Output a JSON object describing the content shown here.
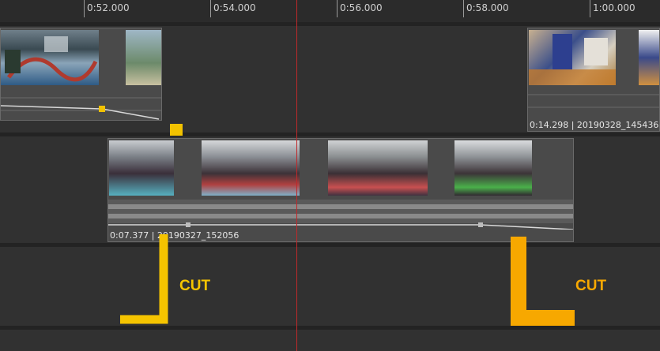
{
  "ruler": {
    "labels": [
      "0:52.000",
      "0:54.000",
      "0:56.000",
      "0:58.000",
      "1:00.000"
    ]
  },
  "clips": {
    "top_left": {
      "label": ""
    },
    "top_right": {
      "label": "0:14.298 | 20190328_145436"
    },
    "middle": {
      "label": "0:07.377 | 20190327_152056"
    }
  },
  "annotations": {
    "cut_left": {
      "label": "CUT",
      "color": "#f5c400"
    },
    "cut_right": {
      "label": "CUT",
      "color": "#f7a800"
    }
  },
  "colors": {
    "playhead": "#c0282a",
    "keyframe": "#f2c200",
    "track_bg": "#313131"
  }
}
